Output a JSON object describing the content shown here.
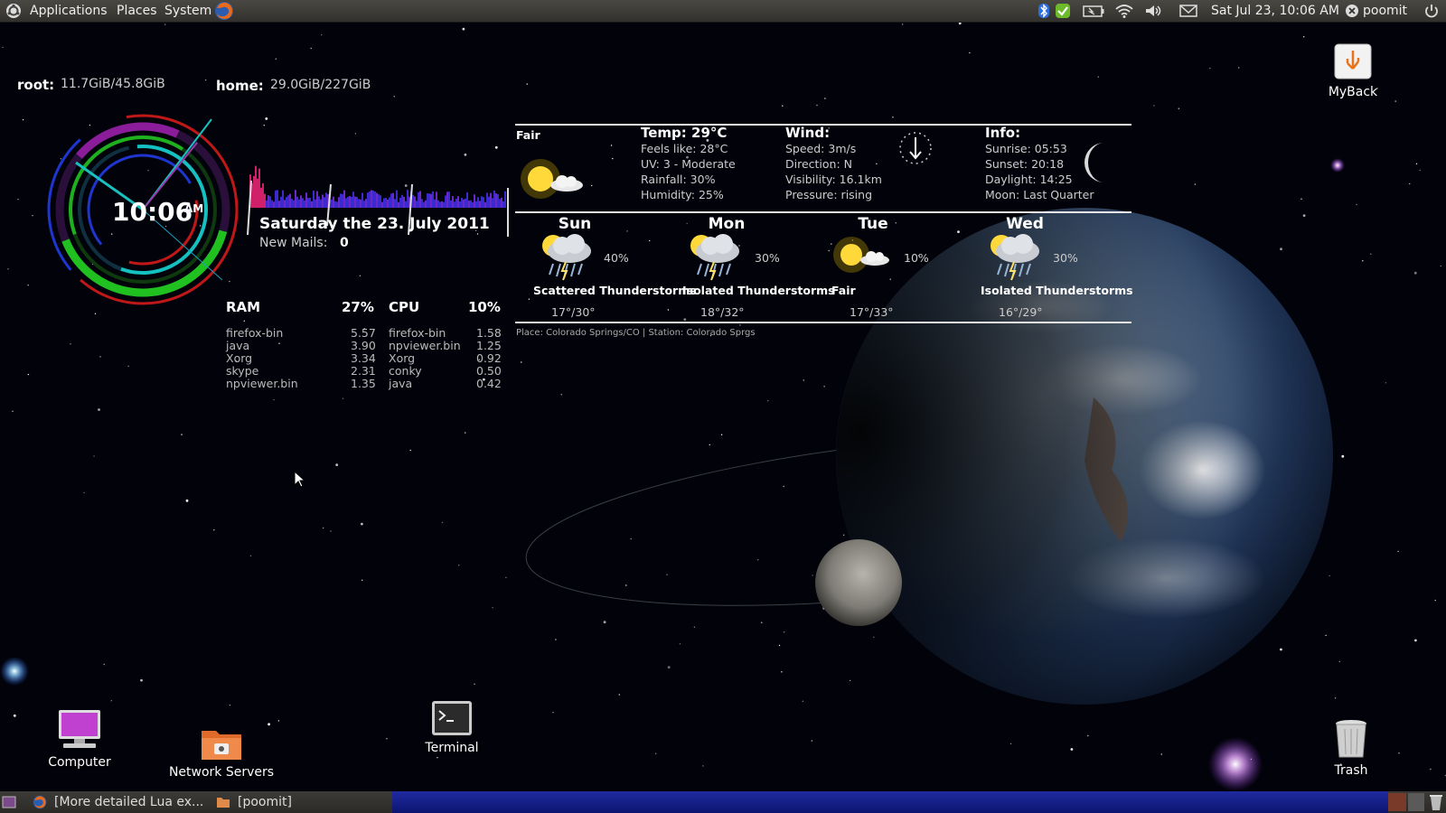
{
  "top_panel": {
    "menus": [
      "Applications",
      "Places",
      "System"
    ],
    "datetime": "Sat Jul 23, 10:06 AM",
    "user": "poomit",
    "icons": [
      "ubuntu-logo-icon",
      "firefox-icon",
      "bluetooth-icon",
      "update-icon",
      "battery-icon",
      "wifi-icon",
      "volume-icon",
      "mail-icon",
      "user-icon",
      "power-icon"
    ]
  },
  "disk": {
    "root_label": "root:",
    "root_value": "11.7GiB/45.8GiB",
    "home_label": "home:",
    "home_value": "29.0GiB/227GiB"
  },
  "clock": {
    "time": "10:06",
    "ampm": "AM"
  },
  "date_line": "Saturday the 23. July 2011",
  "mail": {
    "label": "New Mails:",
    "count": "0"
  },
  "ram": {
    "label": "RAM",
    "percent": "27%",
    "processes": [
      {
        "name": "firefox-bin",
        "value": "5.57"
      },
      {
        "name": "java",
        "value": "3.90"
      },
      {
        "name": "Xorg",
        "value": "3.34"
      },
      {
        "name": "skype",
        "value": "2.31"
      },
      {
        "name": "npviewer.bin",
        "value": "1.35"
      }
    ]
  },
  "cpu": {
    "label": "CPU",
    "percent": "10%",
    "processes": [
      {
        "name": "firefox-bin",
        "value": "1.58"
      },
      {
        "name": "npviewer.bin",
        "value": "1.25"
      },
      {
        "name": "Xorg",
        "value": "0.92"
      },
      {
        "name": "conky",
        "value": "0.50"
      },
      {
        "name": "java",
        "value": "0.42"
      }
    ]
  },
  "weather": {
    "current_condition": "Fair",
    "temp": {
      "title": "Temp:  29°C",
      "lines": [
        "Feels like: 28°C",
        "UV: 3 - Moderate",
        "Rainfall: 30%",
        "Humidity: 25%"
      ]
    },
    "wind": {
      "title": "Wind:",
      "lines": [
        "Speed: 3m/s",
        "Direction: N",
        "Visibility: 16.1km",
        "Pressure: rising"
      ]
    },
    "info": {
      "title": "Info:",
      "lines": [
        "Sunrise: 05:53",
        "Sunset: 20:18",
        "Daylight: 14:25",
        "Moon: Last Quarter"
      ]
    },
    "forecast": [
      {
        "day": "Sun",
        "pct": "40%",
        "cond": "Scattered Thunderstorms",
        "temps": "17°/30°"
      },
      {
        "day": "Mon",
        "pct": "30%",
        "cond": "Isolated Thunderstorms",
        "temps": "18°/32°"
      },
      {
        "day": "Tue",
        "pct": "10%",
        "cond": "Fair",
        "temps": "17°/33°"
      },
      {
        "day": "Wed",
        "pct": "30%",
        "cond": "Isolated Thunderstorms",
        "temps": "16°/29°"
      }
    ],
    "place": "Place:  Colorado Springs/CO | Station:  Colorado Sprgs"
  },
  "desktop_icons": {
    "myback": "MyBack",
    "computer": "Computer",
    "network": "Network Servers",
    "terminal": "Terminal",
    "trash": "Trash"
  },
  "bottom_panel": {
    "tasks": [
      "[More detailed Lua ex...",
      "[poomit]"
    ]
  }
}
